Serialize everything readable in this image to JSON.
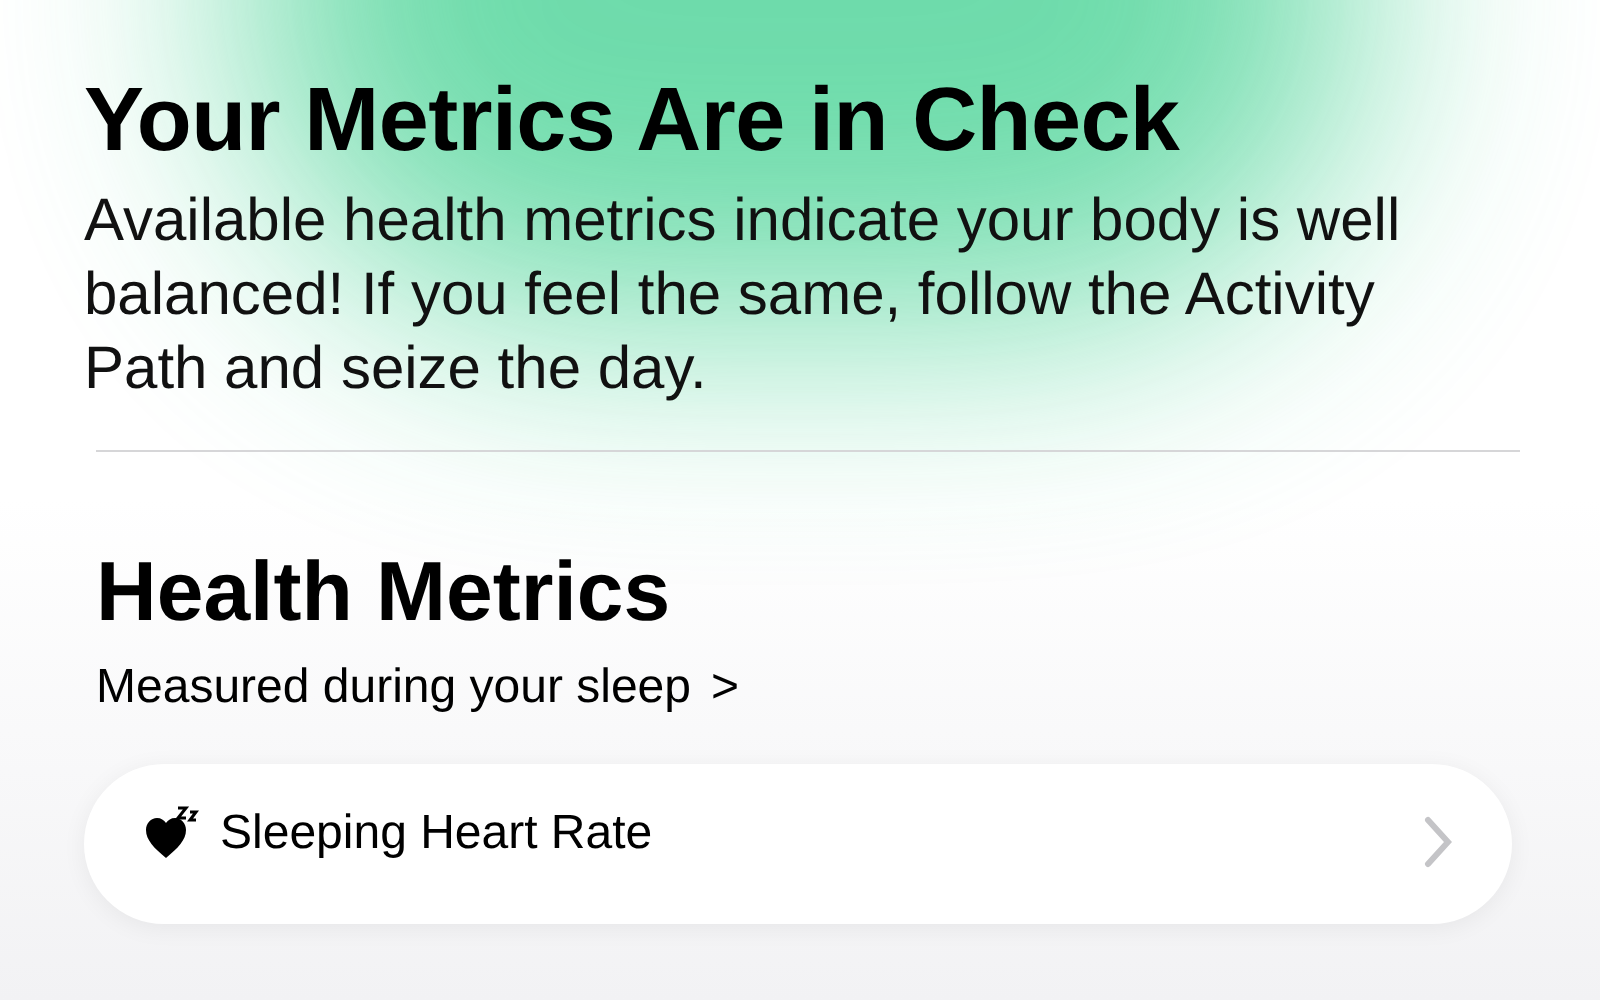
{
  "header": {
    "title": "Your Metrics Are in Check",
    "description": "Available health metrics indicate your body is well balanced! If you feel the same, follow the Activity Path and seize the day."
  },
  "section": {
    "title": "Health Metrics",
    "link": "Measured during your sleep",
    "link_chevron": ">"
  },
  "cards": [
    {
      "kind": "sleep-heart",
      "title": "Sleeping Heart Rate"
    }
  ]
}
